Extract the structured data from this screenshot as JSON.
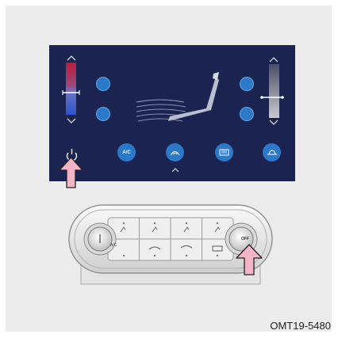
{
  "screen": {
    "ac_label": "A/C",
    "power_icon": "power-icon",
    "left_temp_icon": "temperature-bar",
    "right_temp_icon": "temperature-bar",
    "colors": {
      "screen_bg": "#1b2450",
      "button_blue": "#2c79c9",
      "arrow_pink": "#f4b4c8"
    }
  },
  "panel": {
    "ac_label": "A/C",
    "off_label": "OFF"
  },
  "caption": "OMT19-5480"
}
